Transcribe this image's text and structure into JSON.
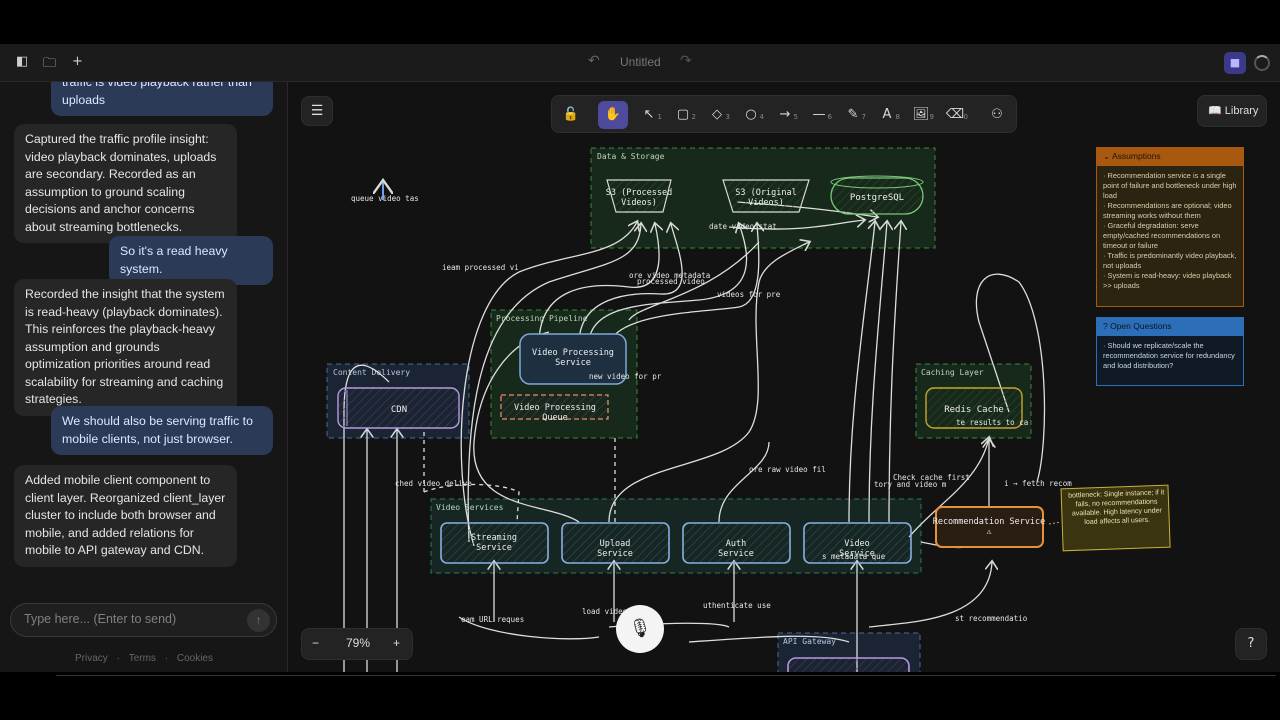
{
  "topbar": {
    "title": "Untitled",
    "icons": [
      "sidebar-toggle-icon",
      "folder-icon",
      "plus-icon",
      "undo-icon",
      "redo-icon",
      "video-icon",
      "spinner-icon"
    ]
  },
  "chat": {
    "messages": [
      {
        "role": "user",
        "text": "traffic is video playback rather than uploads"
      },
      {
        "role": "bot",
        "text": "Captured the traffic profile insight: video playback dominates, uploads are secondary. Recorded as an assumption to ground scaling decisions and anchor concerns about streaming bottlenecks."
      },
      {
        "role": "user",
        "text": "So it's a read heavy system."
      },
      {
        "role": "bot",
        "text": "Recorded the insight that the system is read-heavy (playback dominates). This reinforces the playback-heavy assumption and grounds optimization priorities around read scalability for streaming and caching strategies."
      },
      {
        "role": "user",
        "text": "We should also be serving traffic to mobile clients, not just browser."
      },
      {
        "role": "bot",
        "text": "Added mobile client component to client layer. Reorganized client_layer cluster to include both browser and mobile, and added relations for mobile to API gateway and CDN."
      }
    ],
    "input_placeholder": "Type here... (Enter to send)",
    "footer": [
      "Privacy",
      "Terms",
      "Cookies"
    ],
    "footer_sep": "·"
  },
  "canvas": {
    "toolbar": [
      {
        "name": "lock-tool",
        "icon": "lock-icon",
        "glyph": "🔓",
        "key": ""
      },
      {
        "name": "hand-tool",
        "icon": "hand-icon",
        "glyph": "✋",
        "key": "",
        "active": true
      },
      {
        "name": "select-tool",
        "icon": "pointer-icon",
        "glyph": "↖",
        "key": "1"
      },
      {
        "name": "rectangle-tool",
        "icon": "rectangle-icon",
        "glyph": "▢",
        "key": "2"
      },
      {
        "name": "diamond-tool",
        "icon": "diamond-icon",
        "glyph": "◇",
        "key": "3"
      },
      {
        "name": "ellipse-tool",
        "icon": "circle-icon",
        "glyph": "○",
        "key": "4"
      },
      {
        "name": "arrow-tool",
        "icon": "arrow-icon",
        "glyph": "→",
        "key": "5"
      },
      {
        "name": "line-tool",
        "icon": "line-icon",
        "glyph": "—",
        "key": "6"
      },
      {
        "name": "draw-tool",
        "icon": "pencil-icon",
        "glyph": "✎",
        "key": "7"
      },
      {
        "name": "text-tool",
        "icon": "text-icon",
        "glyph": "A",
        "key": "8"
      },
      {
        "name": "image-tool",
        "icon": "image-icon",
        "glyph": "🖼",
        "key": "9"
      },
      {
        "name": "eraser-tool",
        "icon": "eraser-icon",
        "glyph": "⌫",
        "key": "0"
      },
      {
        "name": "extras-tool",
        "icon": "shapes-icon",
        "glyph": "⚇",
        "key": ""
      }
    ],
    "library_label": "Library",
    "zoom": {
      "minus": "−",
      "value": "79%",
      "plus": "+"
    },
    "help": "?",
    "diagram": {
      "clusters": {
        "data_storage": "Data & Storage",
        "processing": "Processing Pipeline",
        "content_delivery": "Content Delivery",
        "caching": "Caching Layer",
        "video_services": "Video Services",
        "api_gateway": "API Gateway"
      },
      "nodes": {
        "s3_processed": "S3 (Processed Videos)",
        "s3_original": "S3 (Original Videos)",
        "postgres": "PostgreSQL",
        "video_processing": "Video Processing Service",
        "video_queue": "Video Processing Queue",
        "cdn": "CDN",
        "redis": "Redis Cache",
        "streaming": "Streaming Service",
        "upload": "Upload Service",
        "auth": "Auth Service",
        "video_service": "Video Service",
        "recommendation": "Recommendation Service ⚠"
      },
      "edge_labels": [
        "queue video tas",
        "ieam processed vi",
        "ore video metadata",
        "processed video",
        "date video stat",
        "videos for pre",
        "new video for pr",
        "ore raw video fil",
        "Check cache first",
        "tory and video m",
        "te results to ca",
        "i → fetch recom",
        "ched video delive",
        "eam URL reques",
        "load video",
        "uthenticate use",
        "st recommendatio",
        "s metadata que"
      ],
      "bottleneck_note": "bottleneck: Single instance; if it fails, no recommendations available. High latency under load affects all users."
    },
    "assumptions": {
      "title": "Assumptions",
      "items": [
        "Recommendation service is a single point of failure and bottleneck under high load",
        "Recommendations are optional; video streaming works without them",
        "Graceful degradation: serve empty/cached recommendations on timeout or failure",
        "Traffic is predominantly video playback, not uploads",
        "System is read-heavy: video playback >> uploads"
      ]
    },
    "open_questions": {
      "title": "Open Questions",
      "items": [
        "Should we replicate/scale the recommendation service for redundancy and load distribution?"
      ]
    }
  },
  "colors": {
    "storage_green": "#8fd08f",
    "processing_blue": "#7fa8d8",
    "warning_orange": "#e8913a",
    "redis_yellow": "#c9a52a",
    "note_yellow": "#c9b03a",
    "assumptions_header": "#a8590f",
    "questions_header": "#2c6fb8",
    "active_tool": "#4e4a9c"
  }
}
